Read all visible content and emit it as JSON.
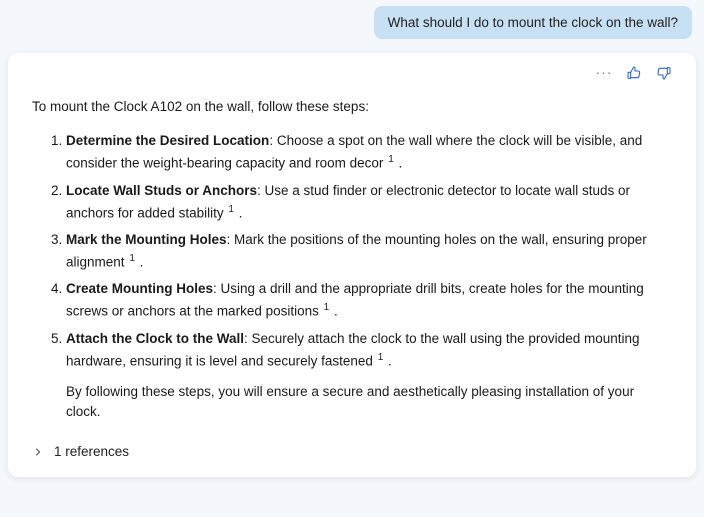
{
  "user": {
    "message": "What should I do to mount the clock on the wall?"
  },
  "assistant": {
    "intro": "To mount the Clock A102 on the wall, follow these steps:",
    "steps": [
      {
        "title": "Determine the Desired Location",
        "body": ": Choose a spot on the wall where the clock will be visible, and consider the weight-bearing capacity and room decor",
        "citation": "1",
        "tail": " ."
      },
      {
        "title": "Locate Wall Studs or Anchors",
        "body": ": Use a stud finder or electronic detector to locate wall studs or anchors for added stability",
        "citation": "1",
        "tail": " ."
      },
      {
        "title": "Mark the Mounting Holes",
        "body": ": Mark the positions of the mounting holes on the wall, ensuring proper alignment",
        "citation": "1",
        "tail": " ."
      },
      {
        "title": "Create Mounting Holes",
        "body": ": Using a drill and the appropriate drill bits, create holes for the mounting screws or anchors at the marked positions",
        "citation": "1",
        "tail": " ."
      },
      {
        "title": "Attach the Clock to the Wall",
        "body": ": Securely attach the clock to the wall using the provided mounting hardware, ensuring it is level and securely fastened",
        "citation": "1",
        "tail": " ."
      }
    ],
    "outro": "By following these steps, you will ensure a secure and aesthetically pleasing installation of your clock.",
    "references_label": "1 references"
  },
  "icons": {
    "more": "more-icon",
    "thumbs_up": "thumbs-up-icon",
    "thumbs_down": "thumbs-down-icon",
    "chevron": "chevron-right-icon"
  }
}
